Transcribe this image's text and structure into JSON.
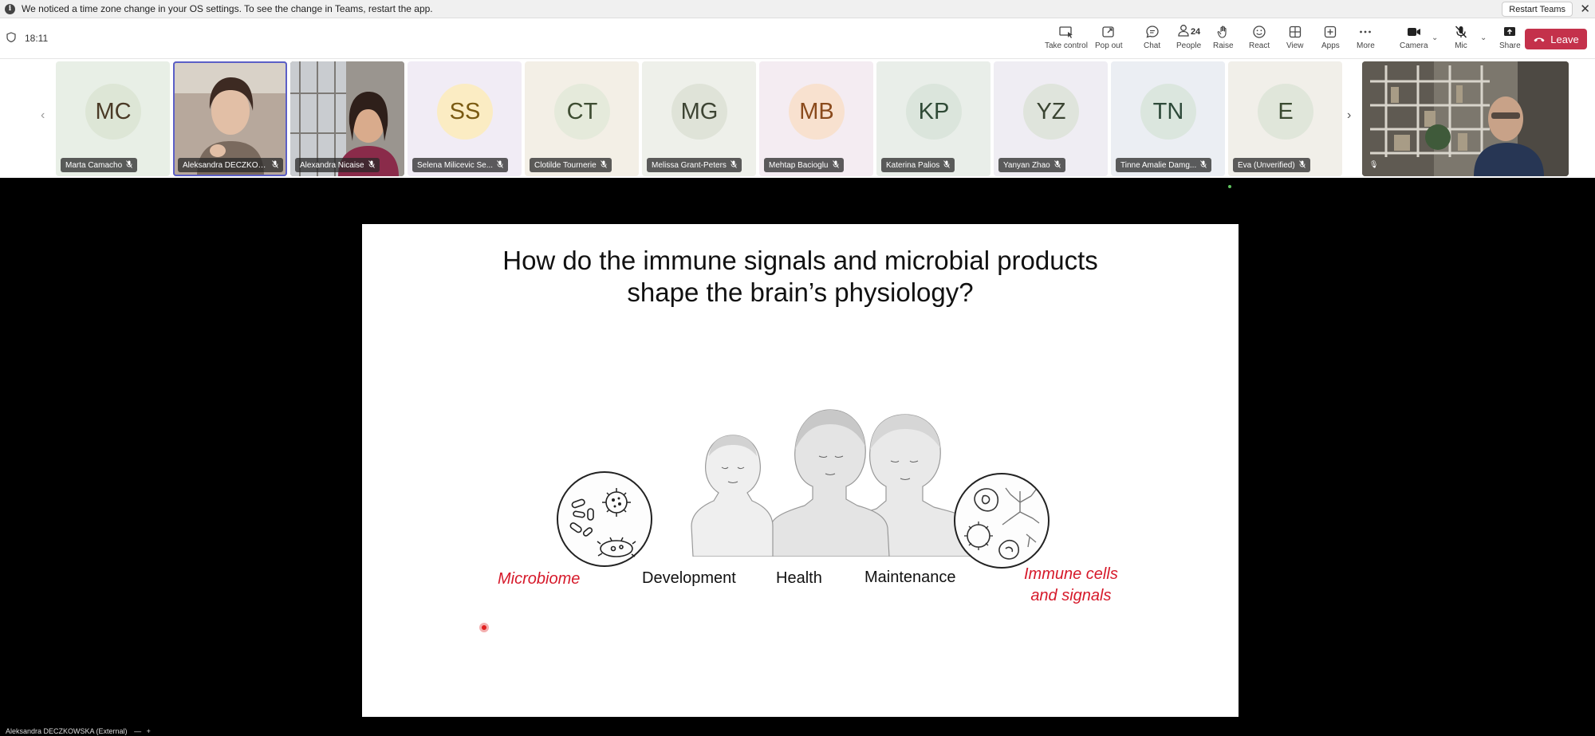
{
  "notification": {
    "text": "We noticed a time zone change in your OS settings. To see the change in Teams, restart the app.",
    "restart_label": "Restart Teams",
    "close_glyph": "✕",
    "info_glyph": "i"
  },
  "meeting": {
    "time": "18:11"
  },
  "toolbar": {
    "take_control": "Take control",
    "pop_out": "Pop out",
    "chat": "Chat",
    "people": "People",
    "people_count": "24",
    "raise": "Raise",
    "react": "React",
    "view": "View",
    "apps": "Apps",
    "more": "More",
    "camera": "Camera",
    "mic": "Mic",
    "share": "Share",
    "leave": "Leave"
  },
  "participants": [
    {
      "initials": "MC",
      "name": "Marta Camacho",
      "bg": "#e8efe6",
      "avatar_bg": "#dde6d6",
      "fg": "#4a3a26"
    },
    {
      "initials": "",
      "name": "Aleksandra DECZKOWS...",
      "bg": "#a58f82",
      "avatar_bg": "",
      "fg": ""
    },
    {
      "initials": "",
      "name": "Alexandra Nicaise",
      "bg": "#8d8a86",
      "avatar_bg": "",
      "fg": ""
    },
    {
      "initials": "SS",
      "name": "Selena Milicevic Se...",
      "bg": "#f1ecf5",
      "avatar_bg": "#fbecc3",
      "fg": "#7a5a12"
    },
    {
      "initials": "CT",
      "name": "Clotilde Tournerie",
      "bg": "#f3efe6",
      "avatar_bg": "#e5eadb",
      "fg": "#3e4d32"
    },
    {
      "initials": "MG",
      "name": "Melissa Grant-Peters",
      "bg": "#eef0ea",
      "avatar_bg": "#dfe3d8",
      "fg": "#3e4534"
    },
    {
      "initials": "MB",
      "name": "Mehtap Bacioglu",
      "bg": "#f4ecf2",
      "avatar_bg": "#f8e1cf",
      "fg": "#8a4a1c"
    },
    {
      "initials": "KP",
      "name": "Katerina Palios",
      "bg": "#e9eee9",
      "avatar_bg": "#dbe5dc",
      "fg": "#2f4a36"
    },
    {
      "initials": "YZ",
      "name": "Yanyan Zhao",
      "bg": "#efedf3",
      "avatar_bg": "#dfe4dc",
      "fg": "#3a4432"
    },
    {
      "initials": "TN",
      "name": "Tinne Amalie Damg...",
      "bg": "#ebeef3",
      "avatar_bg": "#dbe6de",
      "fg": "#2e4a3a"
    },
    {
      "initials": "E",
      "name": "Eva (Unverified)",
      "bg": "#f1efe9",
      "avatar_bg": "#e0e6da",
      "fg": "#3a4a30"
    }
  ],
  "slide": {
    "title_line1": "How do the immune signals and microbial products",
    "title_line2": "shape the brain’s physiology?",
    "label_microbiome": "Microbiome",
    "label_development": "Development",
    "label_health": "Health",
    "label_maintenance": "Maintenance",
    "label_immune_1": "Immune cells",
    "label_immune_2": "and signals"
  },
  "presenter": {
    "name": "Aleksandra DECZKOWSKA (External)"
  },
  "colors": {
    "accent": "#5b5fc7",
    "leave": "#c4314b",
    "slide_red": "#d6192a"
  }
}
